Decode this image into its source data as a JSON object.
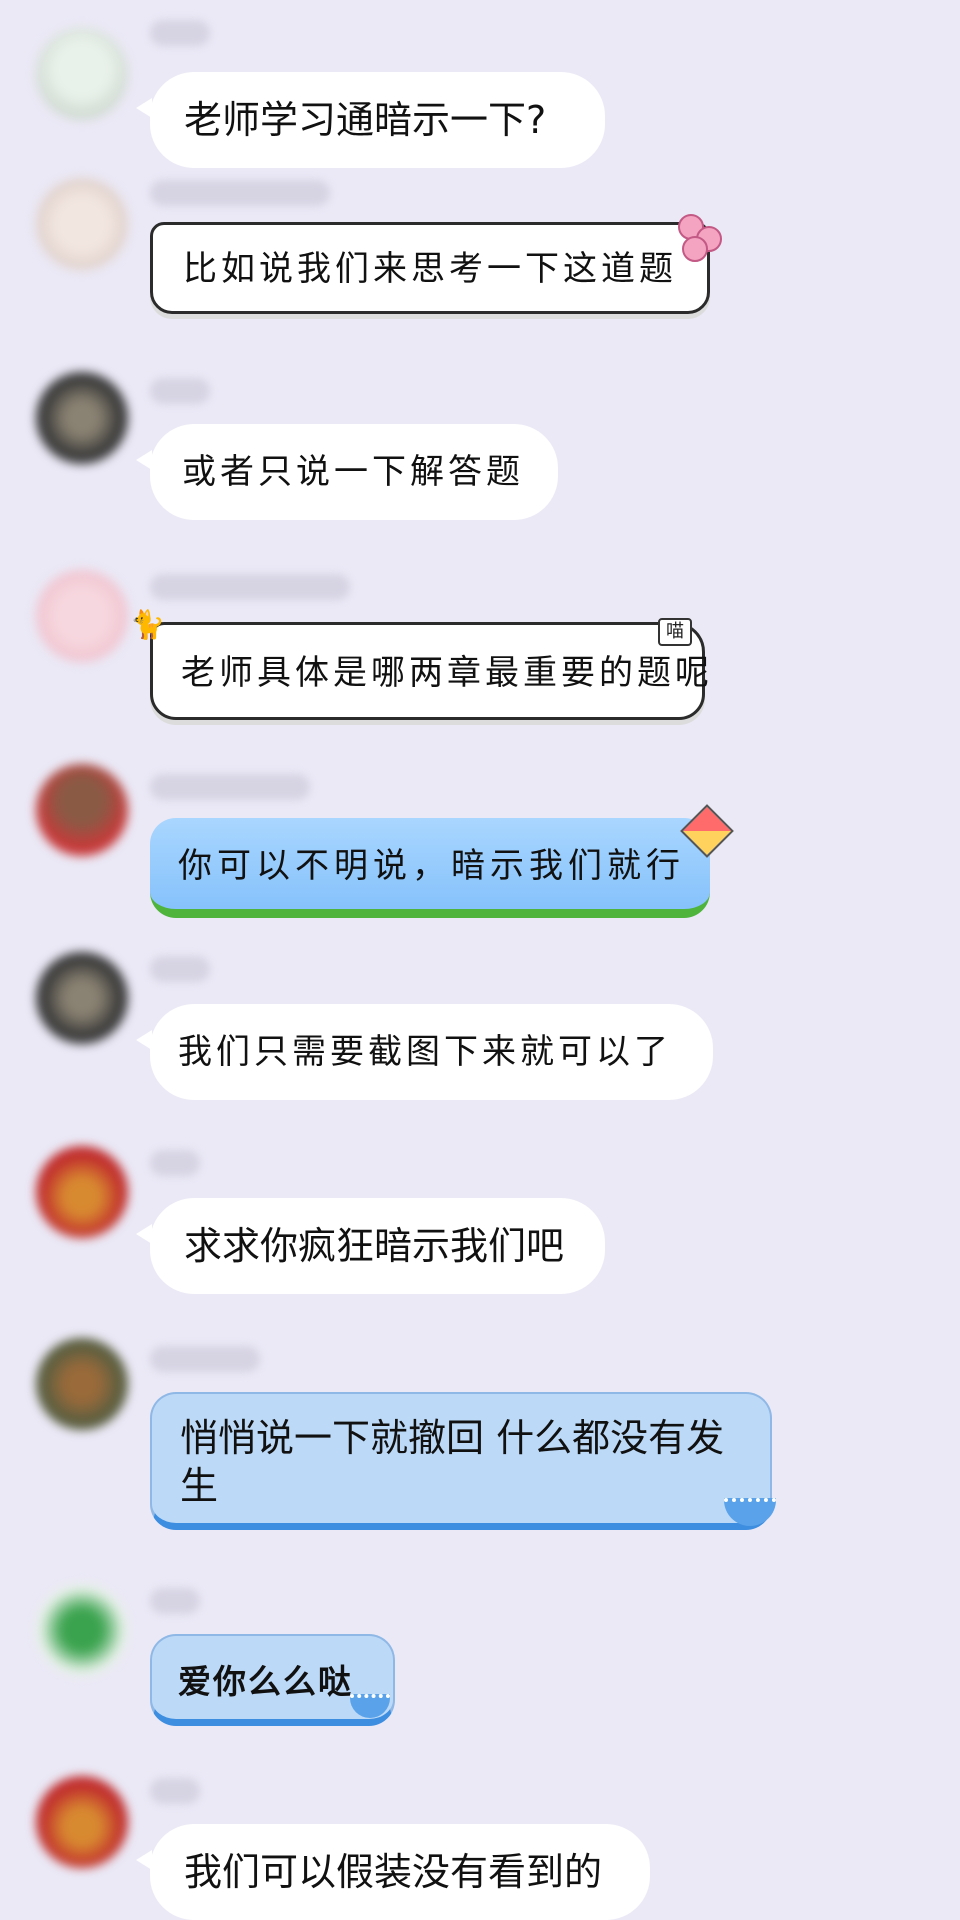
{
  "messages": [
    {
      "text": "老师学习通暗示一下?"
    },
    {
      "text": "比如说我们来思考一下这道题"
    },
    {
      "text": "或者只说一下解答题"
    },
    {
      "text": "老师具体是哪两章最重要的题呢",
      "tag": "喵"
    },
    {
      "text": "你可以不明说，暗示我们就行"
    },
    {
      "text": "我们只需要截图下来就可以了"
    },
    {
      "text": "求求你疯狂暗示我们吧"
    },
    {
      "text": "悄悄说一下就撤回 什么都没有发生"
    },
    {
      "text": "爱你么么哒"
    },
    {
      "text": "我们可以假装没有看到的"
    }
  ],
  "colors": {
    "background": "#ebe9f6",
    "bubble": "#ffffff",
    "blue_bubble": "#86c2fb",
    "light_blue_bubble": "#bcd9f7",
    "grass_border": "#4eb43c"
  },
  "icons": {
    "flowers": "flower-sticker-icon",
    "cat": "cat-sticker-icon",
    "kite": "kite-icon",
    "waves": "wave-icon"
  }
}
